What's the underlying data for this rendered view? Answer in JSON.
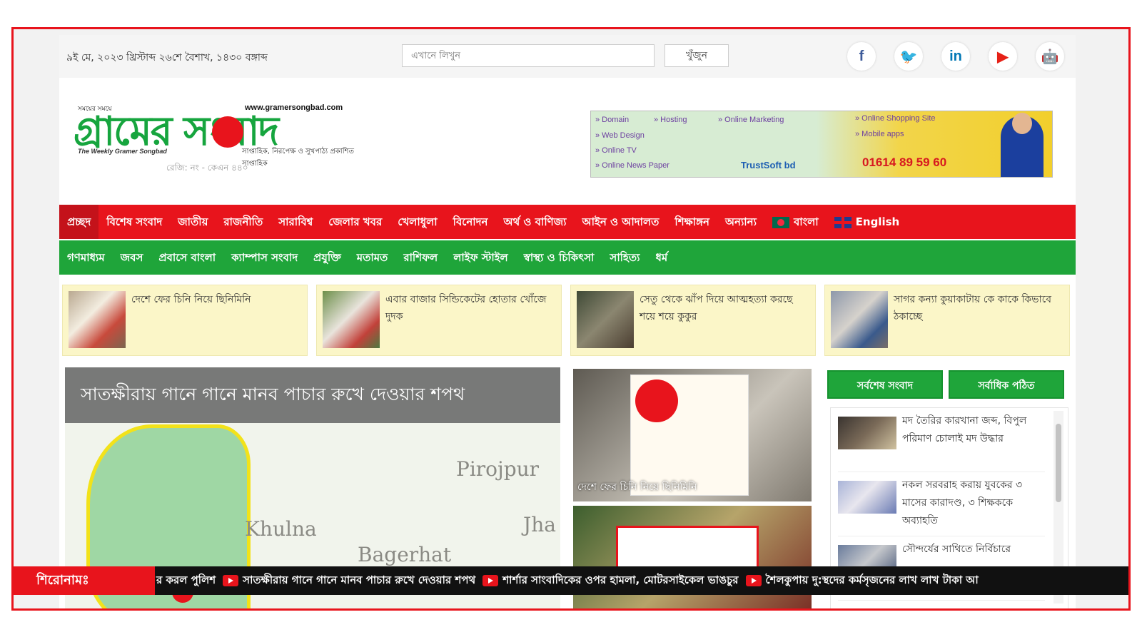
{
  "colors": {
    "brand_red": "#e8141c",
    "brand_green": "#1fa53a",
    "card_yellow": "#fbf6c8"
  },
  "topbar": {
    "date": "৯ই মে, ২০২৩ খ্রিস্টাব্দ ২৬শে বৈশাখ, ১৪৩০ বঙ্গাব্দ",
    "search_placeholder": "এখানে লিখুন",
    "search_button": "খুঁজুন",
    "social": [
      {
        "icon": "facebook-icon",
        "glyph": "f",
        "color": "#3b5998"
      },
      {
        "icon": "twitter-icon",
        "glyph": "🐦",
        "color": "#1da1f2"
      },
      {
        "icon": "linkedin-icon",
        "glyph": "in",
        "color": "#0077b5"
      },
      {
        "icon": "youtube-icon",
        "glyph": "▶",
        "color": "#e62117"
      },
      {
        "icon": "android-icon",
        "glyph": "🤖",
        "color": "#78c257"
      }
    ]
  },
  "logo": {
    "small": "সময়ের সময়ে",
    "url": "www.gramersongbad.com",
    "main": "গ্রামের সংবাদ",
    "tag_en": "The Weekly Gramer Songbad",
    "tag_bn": "সাপ্তাহিক, নিরপেক্ষ ও সুখপাঠ্য প্রকাশিত সাপ্তাহিক",
    "reg": "রেজি: নং - কেএন ৪৪০"
  },
  "ad": {
    "items_col1": [
      "» Domain",
      "» Web Design",
      "» Online TV",
      "» Online News Paper"
    ],
    "item_hosting": "» Hosting",
    "item_marketing": "» Online Marketing",
    "items_col3": [
      "» Online Shopping Site",
      "» Mobile apps"
    ],
    "brand": "TrustSoft bd",
    "phone": "01614 89 59 60"
  },
  "nav_primary": [
    "প্রচ্ছদ",
    "বিশেষ সংবাদ",
    "জাতীয়",
    "রাজনীতি",
    "সারাবিশ্ব",
    "জেলার খবর",
    "খেলাধুলা",
    "বিনোদন",
    "অর্থ ও বাণিজ্য",
    "আইন ও আদালত",
    "শিক্ষাঙ্গন",
    "অন্যান্য"
  ],
  "lang_bn": "বাংলা",
  "lang_en": "English",
  "nav_secondary": [
    "গণমাধ্যম",
    "জবস",
    "প্রবাসে বাংলা",
    "ক্যাম্পাস সংবাদ",
    "প্রযুক্তি",
    "মতামত",
    "রাশিফল",
    "লাইফ স্টাইল",
    "স্বাস্থ্য ও চিকিৎসা",
    "সাহিত্য",
    "ধর্ম"
  ],
  "cards": [
    {
      "title": "দেশে ফের চিনি নিয়ে ছিনিমিনি"
    },
    {
      "title": "এবার বাজার সিন্ডিকেটের হোতার খোঁজে দুদক"
    },
    {
      "title": "সেতু থেকে ঝাঁপ দিয়ে আত্মহত্যা করছে শয়ে শয়ে কুকুর"
    },
    {
      "title": "সাগর কন্যা কুয়াকাটায় কে কাকে কিভাবে ঠকাচ্ছে"
    }
  ],
  "feature": {
    "title": "সাতক্ষীরায় গানে গানে মানব পাচার রুখে দেওয়ার শপথ",
    "map_labels": [
      "Pirojpur",
      "Khulna",
      "Jha",
      "Bagerhat"
    ]
  },
  "middle": {
    "caption1": "দেশে ফের চিনি নিয়ে ছিনিমিনি"
  },
  "sidebar": {
    "tab_latest": "সর্বশেষ সংবাদ",
    "tab_popular": "সর্বাধিক পঠিত",
    "latest": [
      {
        "title": "মদ তৈরির কারখানা জব্দ, বিপুল পরিমাণ চোলাই মদ উদ্ধার"
      },
      {
        "title": "নকল সরবরাহ করায় যুবকের ৩ মাসের কারাদণ্ড, ৩ শিক্ষককে অব্যাহতি"
      },
      {
        "title": "সৌন্দর্যের সাথিতে নির্বিচারে"
      }
    ]
  },
  "ticker": {
    "label": "শিরোনামঃ",
    "items": [
      "র করল পুলিশ",
      "সাতক্ষীরায় গানে গানে মানব পাচার রুখে দেওয়ার শপথ",
      "শার্শার সাংবাদিকের ওপর হামলা, মোটরসাইকেল ভাঙচুর",
      "শৈলকুপায় দু:স্থদের কর্মসৃজনের লাখ লাখ টাকা আ"
    ]
  }
}
